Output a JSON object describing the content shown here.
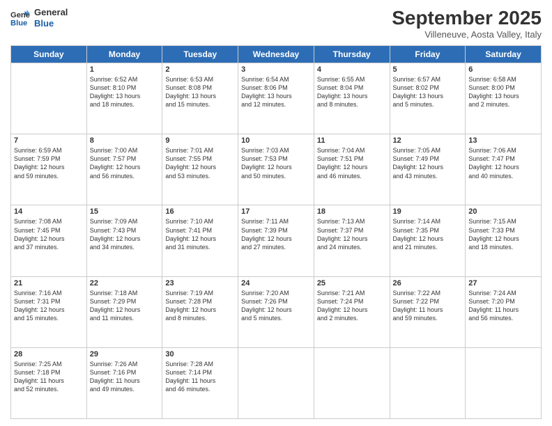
{
  "header": {
    "logo_line1": "General",
    "logo_line2": "Blue",
    "month_title": "September 2025",
    "subtitle": "Villeneuve, Aosta Valley, Italy"
  },
  "days_of_week": [
    "Sunday",
    "Monday",
    "Tuesday",
    "Wednesday",
    "Thursday",
    "Friday",
    "Saturday"
  ],
  "weeks": [
    [
      {
        "day": "",
        "info": ""
      },
      {
        "day": "1",
        "info": "Sunrise: 6:52 AM\nSunset: 8:10 PM\nDaylight: 13 hours\nand 18 minutes."
      },
      {
        "day": "2",
        "info": "Sunrise: 6:53 AM\nSunset: 8:08 PM\nDaylight: 13 hours\nand 15 minutes."
      },
      {
        "day": "3",
        "info": "Sunrise: 6:54 AM\nSunset: 8:06 PM\nDaylight: 13 hours\nand 12 minutes."
      },
      {
        "day": "4",
        "info": "Sunrise: 6:55 AM\nSunset: 8:04 PM\nDaylight: 13 hours\nand 8 minutes."
      },
      {
        "day": "5",
        "info": "Sunrise: 6:57 AM\nSunset: 8:02 PM\nDaylight: 13 hours\nand 5 minutes."
      },
      {
        "day": "6",
        "info": "Sunrise: 6:58 AM\nSunset: 8:00 PM\nDaylight: 13 hours\nand 2 minutes."
      }
    ],
    [
      {
        "day": "7",
        "info": "Sunrise: 6:59 AM\nSunset: 7:59 PM\nDaylight: 12 hours\nand 59 minutes."
      },
      {
        "day": "8",
        "info": "Sunrise: 7:00 AM\nSunset: 7:57 PM\nDaylight: 12 hours\nand 56 minutes."
      },
      {
        "day": "9",
        "info": "Sunrise: 7:01 AM\nSunset: 7:55 PM\nDaylight: 12 hours\nand 53 minutes."
      },
      {
        "day": "10",
        "info": "Sunrise: 7:03 AM\nSunset: 7:53 PM\nDaylight: 12 hours\nand 50 minutes."
      },
      {
        "day": "11",
        "info": "Sunrise: 7:04 AM\nSunset: 7:51 PM\nDaylight: 12 hours\nand 46 minutes."
      },
      {
        "day": "12",
        "info": "Sunrise: 7:05 AM\nSunset: 7:49 PM\nDaylight: 12 hours\nand 43 minutes."
      },
      {
        "day": "13",
        "info": "Sunrise: 7:06 AM\nSunset: 7:47 PM\nDaylight: 12 hours\nand 40 minutes."
      }
    ],
    [
      {
        "day": "14",
        "info": "Sunrise: 7:08 AM\nSunset: 7:45 PM\nDaylight: 12 hours\nand 37 minutes."
      },
      {
        "day": "15",
        "info": "Sunrise: 7:09 AM\nSunset: 7:43 PM\nDaylight: 12 hours\nand 34 minutes."
      },
      {
        "day": "16",
        "info": "Sunrise: 7:10 AM\nSunset: 7:41 PM\nDaylight: 12 hours\nand 31 minutes."
      },
      {
        "day": "17",
        "info": "Sunrise: 7:11 AM\nSunset: 7:39 PM\nDaylight: 12 hours\nand 27 minutes."
      },
      {
        "day": "18",
        "info": "Sunrise: 7:13 AM\nSunset: 7:37 PM\nDaylight: 12 hours\nand 24 minutes."
      },
      {
        "day": "19",
        "info": "Sunrise: 7:14 AM\nSunset: 7:35 PM\nDaylight: 12 hours\nand 21 minutes."
      },
      {
        "day": "20",
        "info": "Sunrise: 7:15 AM\nSunset: 7:33 PM\nDaylight: 12 hours\nand 18 minutes."
      }
    ],
    [
      {
        "day": "21",
        "info": "Sunrise: 7:16 AM\nSunset: 7:31 PM\nDaylight: 12 hours\nand 15 minutes."
      },
      {
        "day": "22",
        "info": "Sunrise: 7:18 AM\nSunset: 7:29 PM\nDaylight: 12 hours\nand 11 minutes."
      },
      {
        "day": "23",
        "info": "Sunrise: 7:19 AM\nSunset: 7:28 PM\nDaylight: 12 hours\nand 8 minutes."
      },
      {
        "day": "24",
        "info": "Sunrise: 7:20 AM\nSunset: 7:26 PM\nDaylight: 12 hours\nand 5 minutes."
      },
      {
        "day": "25",
        "info": "Sunrise: 7:21 AM\nSunset: 7:24 PM\nDaylight: 12 hours\nand 2 minutes."
      },
      {
        "day": "26",
        "info": "Sunrise: 7:22 AM\nSunset: 7:22 PM\nDaylight: 11 hours\nand 59 minutes."
      },
      {
        "day": "27",
        "info": "Sunrise: 7:24 AM\nSunset: 7:20 PM\nDaylight: 11 hours\nand 56 minutes."
      }
    ],
    [
      {
        "day": "28",
        "info": "Sunrise: 7:25 AM\nSunset: 7:18 PM\nDaylight: 11 hours\nand 52 minutes."
      },
      {
        "day": "29",
        "info": "Sunrise: 7:26 AM\nSunset: 7:16 PM\nDaylight: 11 hours\nand 49 minutes."
      },
      {
        "day": "30",
        "info": "Sunrise: 7:28 AM\nSunset: 7:14 PM\nDaylight: 11 hours\nand 46 minutes."
      },
      {
        "day": "",
        "info": ""
      },
      {
        "day": "",
        "info": ""
      },
      {
        "day": "",
        "info": ""
      },
      {
        "day": "",
        "info": ""
      }
    ]
  ]
}
